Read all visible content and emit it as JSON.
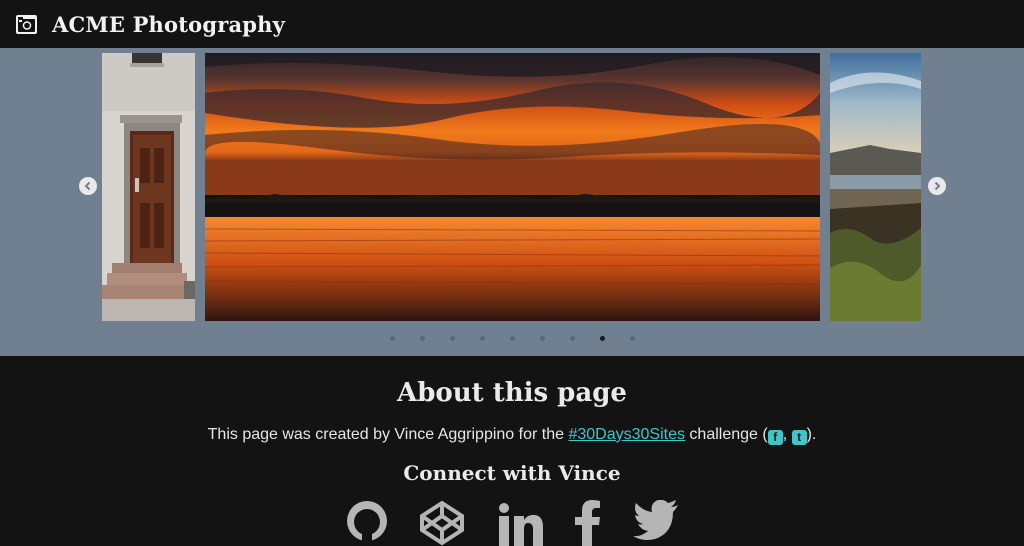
{
  "header": {
    "logo_icon": "camera-icon",
    "title": "ACME Photography"
  },
  "carousel": {
    "background": "#708090",
    "slides": [
      {
        "name": "building-door",
        "position": "left"
      },
      {
        "name": "sunset-lake",
        "position": "center"
      },
      {
        "name": "coastal-beach",
        "position": "right"
      }
    ],
    "prev_icon": "chevron-left-icon",
    "next_icon": "chevron-right-icon",
    "dot_count": 9,
    "active_dot": 8
  },
  "about": {
    "title": "About this page",
    "text_prefix": "This page was created by Vince Aggrippino for the ",
    "challenge_link": "#30Days30Sites",
    "text_middle": " challenge (",
    "separator": ", ",
    "text_suffix": ").",
    "facebook_icon": "facebook-square-icon",
    "twitter_icon": "twitter-square-icon",
    "link_color": "#3ec7c9"
  },
  "connect": {
    "title": "Connect with Vince",
    "icons": [
      "github-icon",
      "codepen-icon",
      "linkedin-icon",
      "facebook-icon",
      "twitter-icon"
    ]
  }
}
